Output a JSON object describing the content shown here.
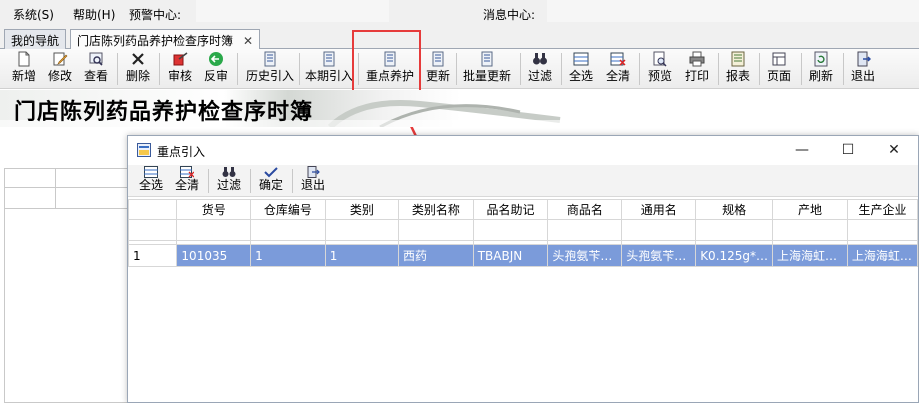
{
  "menu": {
    "system": "系统(S)",
    "help": "帮助(H)",
    "alert_center": "预警中心:",
    "message_center": "消息中心:"
  },
  "tabs": [
    {
      "label": "我的导航"
    },
    {
      "label": "门店陈列药品养护检查序时簿"
    }
  ],
  "toolbar": [
    {
      "label": "新增",
      "icon": "new-doc-icon"
    },
    {
      "label": "修改",
      "icon": "edit-icon"
    },
    {
      "label": "查看",
      "icon": "view-icon"
    },
    {
      "label": "删除",
      "icon": "delete-icon"
    },
    {
      "label": "审核",
      "icon": "audit-icon"
    },
    {
      "label": "反审",
      "icon": "unaudit-icon"
    },
    {
      "label": "历史引入",
      "icon": "import-icon"
    },
    {
      "label": "本期引入",
      "icon": "import-icon"
    },
    {
      "label": "重点养护",
      "icon": "import-icon"
    },
    {
      "label": "更新",
      "icon": "import-icon"
    },
    {
      "label": "批量更新",
      "icon": "import-icon"
    },
    {
      "label": "过滤",
      "icon": "binoculars-icon"
    },
    {
      "label": "全选",
      "icon": "select-all-icon"
    },
    {
      "label": "全清",
      "icon": "clear-all-icon"
    },
    {
      "label": "预览",
      "icon": "preview-icon"
    },
    {
      "label": "打印",
      "icon": "printer-icon"
    },
    {
      "label": "报表",
      "icon": "report-icon"
    },
    {
      "label": "页面",
      "icon": "page-icon"
    },
    {
      "label": "刷新",
      "icon": "refresh-icon"
    },
    {
      "label": "退出",
      "icon": "exit-icon"
    }
  ],
  "banner": {
    "title": "门店陈列药品养护检查序时簿"
  },
  "dialog": {
    "title": "重点引入",
    "toolbar": [
      {
        "label": "全选",
        "icon": "select-all-icon"
      },
      {
        "label": "全清",
        "icon": "clear-all-icon"
      },
      {
        "label": "过滤",
        "icon": "binoculars-icon"
      },
      {
        "label": "确定",
        "icon": "check-icon"
      },
      {
        "label": "退出",
        "icon": "exit-icon"
      }
    ],
    "columns": [
      "货号",
      "仓库编号",
      "类别",
      "类别名称",
      "品名助记",
      "商品名",
      "通用名",
      "规格",
      "产地",
      "生产企业"
    ],
    "rows": [
      {
        "num": "1",
        "cells": [
          "101035",
          "1",
          "1",
          "西药",
          "TBABJN",
          "头孢氨苄…",
          "头孢氨苄…",
          "K0.125g*…",
          "上海海虹…",
          "上海海虹…"
        ]
      }
    ]
  },
  "colors": {
    "selection": "#7b9bda",
    "highlight_box": "#e63b3b"
  }
}
